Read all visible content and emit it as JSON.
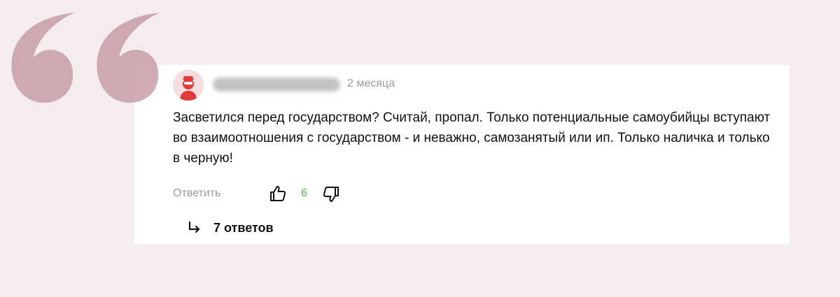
{
  "comment": {
    "date": "2 месяца",
    "text": "Засветился перед государством? Считай, пропал. Только потенциальные самоубийцы вступают во взаимоотношения с государством - и неважно, самозанятый или ип. Только наличка и только в черную!",
    "reply_label": "Ответить",
    "like_count": "6",
    "replies_label": "7 ответов"
  },
  "colors": {
    "page_bg": "#f5ecee",
    "card_bg": "#ffffff",
    "quote_mark": "#c79aa3",
    "like_count": "#3cbf3c",
    "avatar": "#e03a3a"
  },
  "icons": [
    "quote-mark-icon",
    "avatar-icon",
    "thumbs-up-icon",
    "thumbs-down-icon",
    "reply-arrow-icon"
  ]
}
